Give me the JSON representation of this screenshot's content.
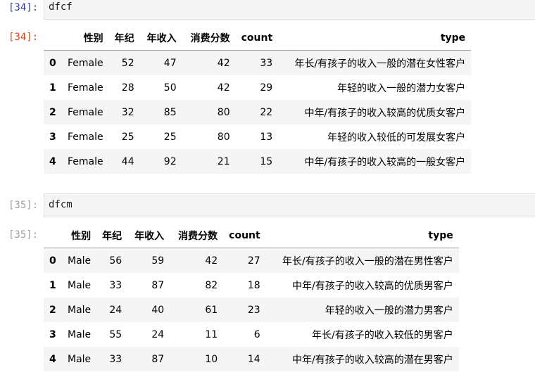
{
  "cells": [
    {
      "in_prompt": "[34]:",
      "code": "dfcf",
      "out_prompt": "[34]:",
      "columns": [
        "性别",
        "年纪",
        "年收入",
        "消费分数",
        "count",
        "type"
      ],
      "rows": [
        {
          "idx": "0",
          "cells": [
            "Female",
            "52",
            "47",
            "42",
            "33",
            "年长/有孩子的收入一般的潜在女性客户"
          ]
        },
        {
          "idx": "1",
          "cells": [
            "Female",
            "28",
            "50",
            "42",
            "29",
            "年轻的收入一般的潜力女客户"
          ]
        },
        {
          "idx": "2",
          "cells": [
            "Female",
            "32",
            "85",
            "80",
            "22",
            "中年/有孩子的收入较高的优质女客户"
          ]
        },
        {
          "idx": "3",
          "cells": [
            "Female",
            "25",
            "25",
            "80",
            "13",
            "年轻的收入较低的可发展女客户"
          ]
        },
        {
          "idx": "4",
          "cells": [
            "Female",
            "44",
            "92",
            "21",
            "15",
            "中年/有孩子的收入较高的一般女客户"
          ]
        }
      ]
    },
    {
      "in_prompt": "[35]:",
      "code": "dfcm",
      "out_prompt": "[35]:",
      "columns": [
        "性别",
        "年纪",
        "年收入",
        "消费分数",
        "count",
        "type"
      ],
      "rows": [
        {
          "idx": "0",
          "cells": [
            "Male",
            "56",
            "59",
            "42",
            "27",
            "年长/有孩子的收入一般的潜在男性客户"
          ]
        },
        {
          "idx": "1",
          "cells": [
            "Male",
            "33",
            "87",
            "82",
            "18",
            "中年/有孩子的收入较高的优质男客户"
          ]
        },
        {
          "idx": "2",
          "cells": [
            "Male",
            "24",
            "40",
            "61",
            "23",
            "年轻的收入一般的潜力男客户"
          ]
        },
        {
          "idx": "3",
          "cells": [
            "Male",
            "55",
            "24",
            "11",
            "6",
            "年长/有孩子的收入较低的男客户"
          ]
        },
        {
          "idx": "4",
          "cells": [
            "Male",
            "33",
            "87",
            "10",
            "14",
            "中年/有孩子的收入较高的潜在男客户"
          ]
        }
      ]
    }
  ]
}
